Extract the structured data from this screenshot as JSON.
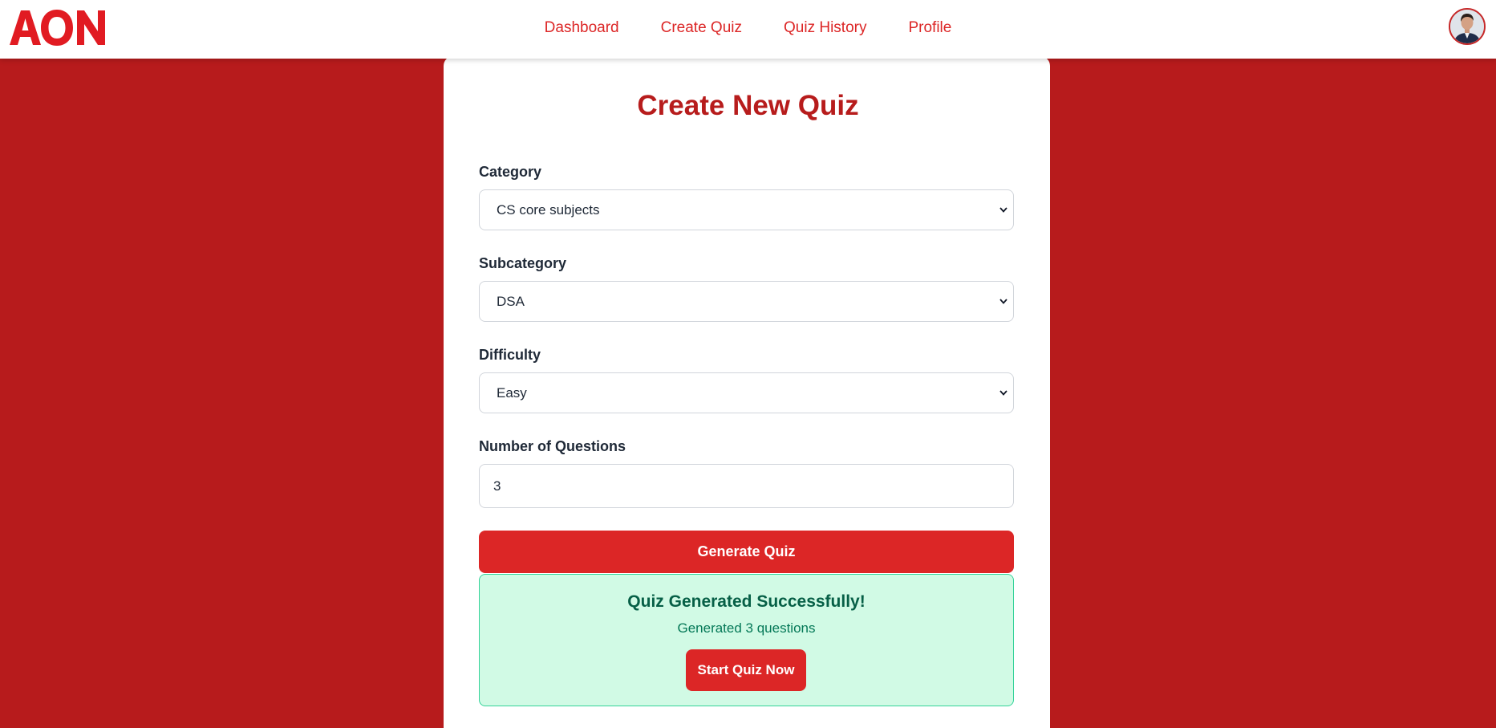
{
  "brand": {
    "logo_text": "AON",
    "logo_color": "#e11b22"
  },
  "nav": {
    "items": [
      {
        "label": "Dashboard"
      },
      {
        "label": "Create Quiz"
      },
      {
        "label": "Quiz History"
      },
      {
        "label": "Profile"
      }
    ]
  },
  "user": {
    "avatar_icon": "user-avatar-photo"
  },
  "form": {
    "title": "Create New Quiz",
    "category": {
      "label": "Category",
      "value": "CS core subjects"
    },
    "subcategory": {
      "label": "Subcategory",
      "value": "DSA"
    },
    "difficulty": {
      "label": "Difficulty",
      "value": "Easy"
    },
    "num_questions": {
      "label": "Number of Questions",
      "value": "3"
    },
    "generate_label": "Generate Quiz"
  },
  "result": {
    "title": "Quiz Generated Successfully!",
    "subtitle": "Generated 3 questions",
    "start_label": "Start Quiz Now"
  },
  "colors": {
    "page_background": "#b71b1c",
    "accent": "#dc2626",
    "title": "#b71c1c",
    "success_bg": "#d1fae5",
    "success_border": "#34d399",
    "success_text": "#065f46"
  }
}
